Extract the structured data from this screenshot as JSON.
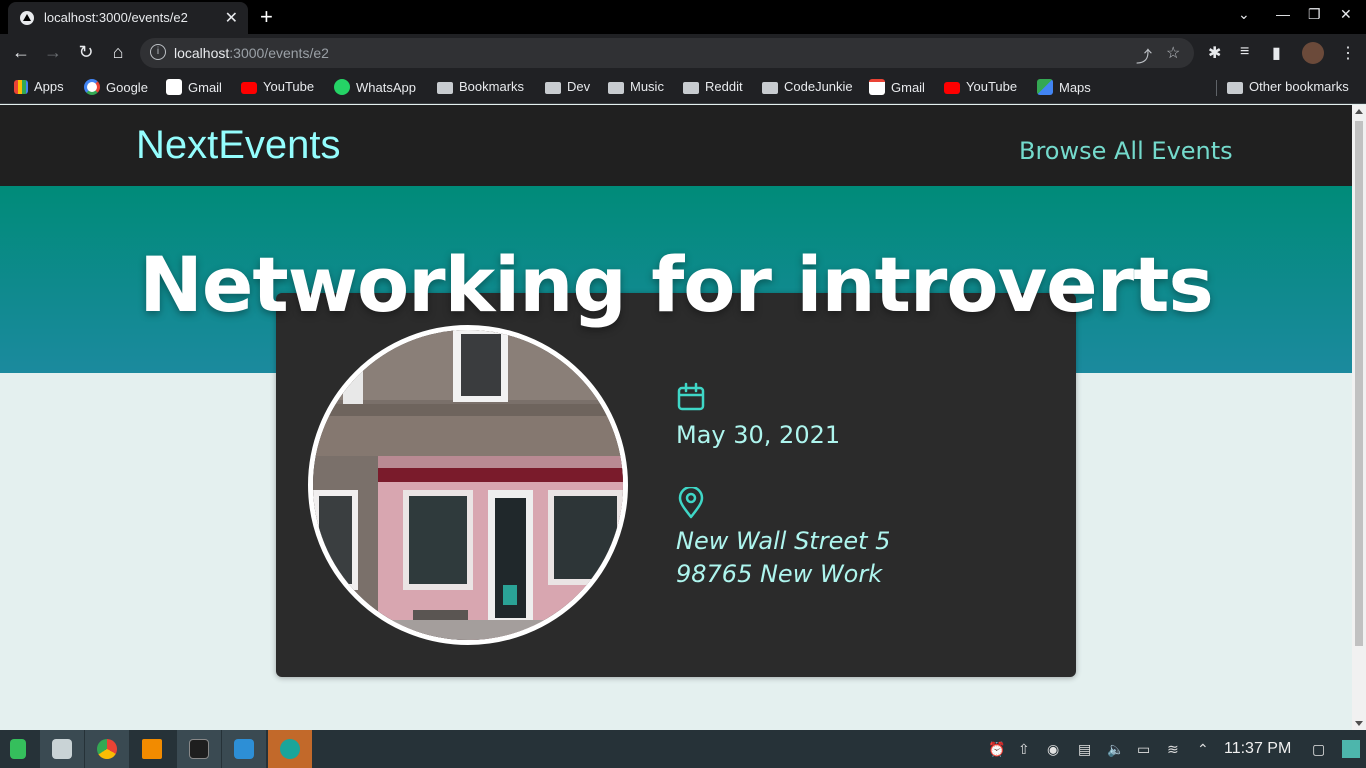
{
  "browser": {
    "tab_title": "localhost:3000/events/e2",
    "url_host": "localhost",
    "url_path": ":3000/events/e2",
    "bookmarks": [
      {
        "label": "Apps",
        "icon": "apps-grid-icon"
      },
      {
        "label": "Google",
        "icon": "google-icon"
      },
      {
        "label": "Gmail",
        "icon": "gmail-icon"
      },
      {
        "label": "YouTube",
        "icon": "youtube-icon"
      },
      {
        "label": "WhatsApp",
        "icon": "whatsapp-icon"
      },
      {
        "label": "Bookmarks",
        "icon": "folder-icon"
      },
      {
        "label": "Dev",
        "icon": "folder-icon"
      },
      {
        "label": "Music",
        "icon": "folder-icon"
      },
      {
        "label": "Reddit",
        "icon": "folder-icon"
      },
      {
        "label": "CodeJunkie",
        "icon": "folder-icon"
      },
      {
        "label": "Gmail",
        "icon": "gmail-icon"
      },
      {
        "label": "YouTube",
        "icon": "youtube-icon"
      },
      {
        "label": "Maps",
        "icon": "maps-icon"
      }
    ],
    "other_bookmarks": "Other bookmarks"
  },
  "site": {
    "logo": "NextEvents",
    "nav_link": "Browse All Events"
  },
  "event": {
    "title": "Networking for introverts",
    "date": "May 30, 2021",
    "address_line1": "New Wall Street 5",
    "address_line2": "98765 New Work"
  },
  "taskbar": {
    "time": "11:37 PM"
  },
  "colors": {
    "accent": "#94fdfd",
    "hero_top": "#008b79",
    "hero_bottom": "#1b8a9e",
    "card": "#2b2b2b",
    "icon": "#3fd7c7"
  }
}
